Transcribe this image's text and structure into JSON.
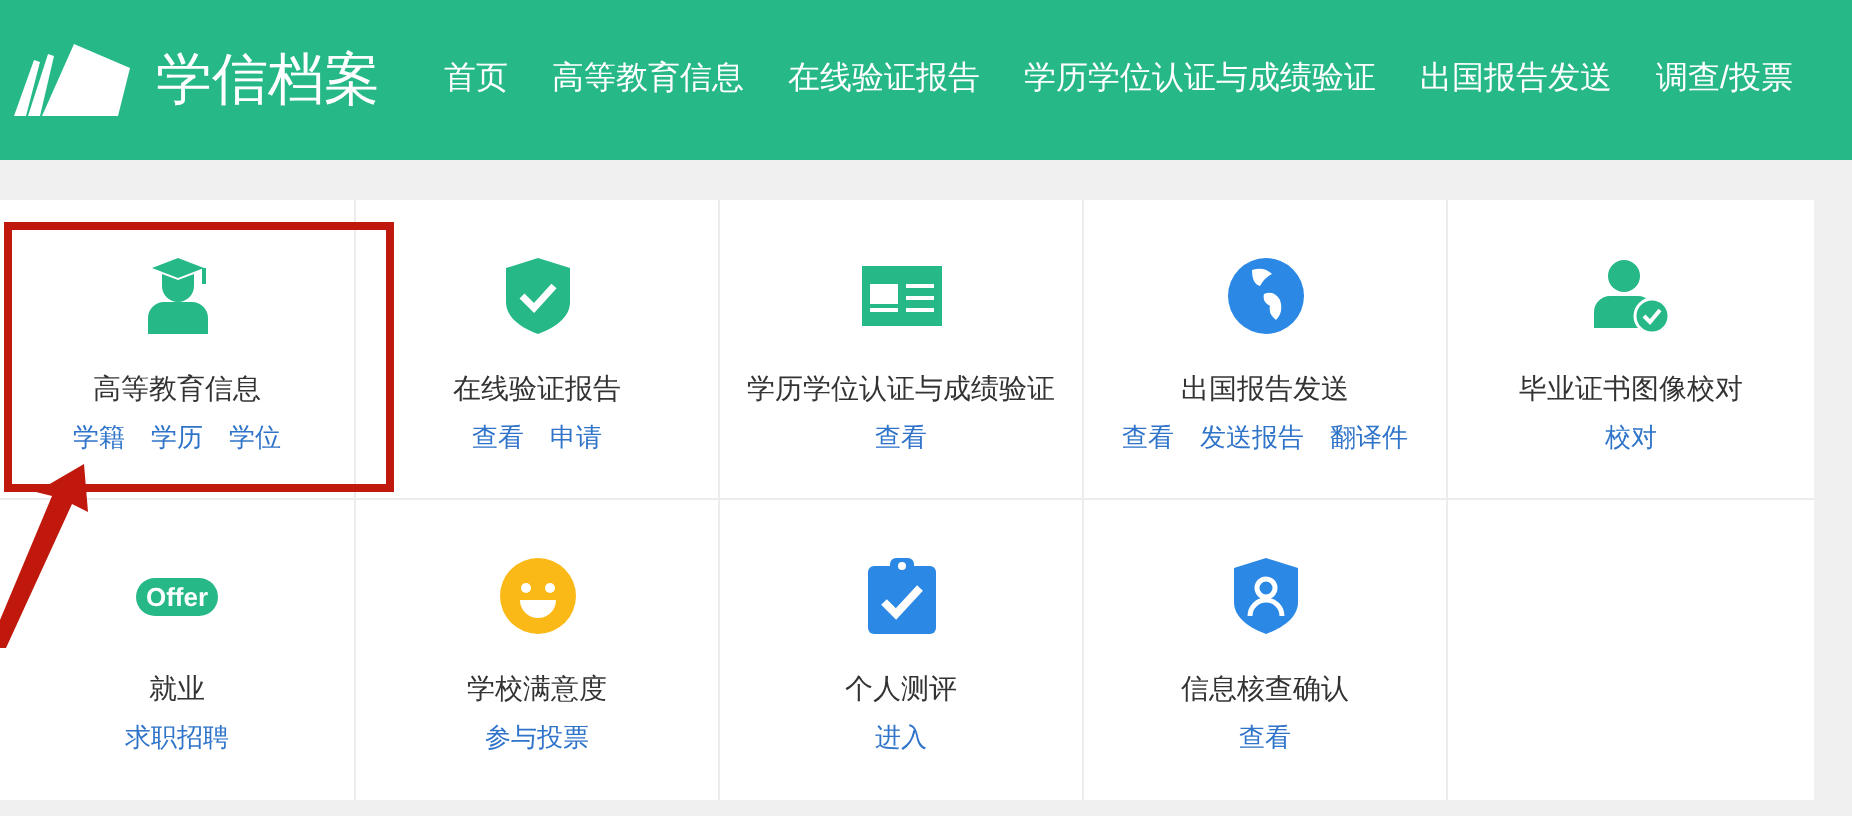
{
  "header": {
    "logo_text": "学信档案",
    "nav": [
      {
        "label": "首页"
      },
      {
        "label": "高等教育信息"
      },
      {
        "label": "在线验证报告"
      },
      {
        "label": "学历学位认证与成绩验证"
      },
      {
        "label": "出国报告发送"
      },
      {
        "label": "调查/投票"
      }
    ]
  },
  "tiles": [
    {
      "title": "高等教育信息",
      "links": [
        "学籍",
        "学历",
        "学位"
      ],
      "highlighted": true
    },
    {
      "title": "在线验证报告",
      "links": [
        "查看",
        "申请"
      ],
      "highlighted": false
    },
    {
      "title": "学历学位认证与成绩验证",
      "links": [
        "查看"
      ],
      "highlighted": false
    },
    {
      "title": "出国报告发送",
      "links": [
        "查看",
        "发送报告",
        "翻译件"
      ],
      "highlighted": false
    },
    {
      "title": "毕业证书图像校对",
      "links": [
        "校对"
      ],
      "highlighted": false
    },
    {
      "title": "就业",
      "links": [
        "求职招聘"
      ],
      "badge": "Offer",
      "highlighted": false
    },
    {
      "title": "学校满意度",
      "links": [
        "参与投票"
      ],
      "highlighted": false
    },
    {
      "title": "个人测评",
      "links": [
        "进入"
      ],
      "highlighted": false
    },
    {
      "title": "信息核查确认",
      "links": [
        "查看"
      ],
      "highlighted": false
    }
  ]
}
